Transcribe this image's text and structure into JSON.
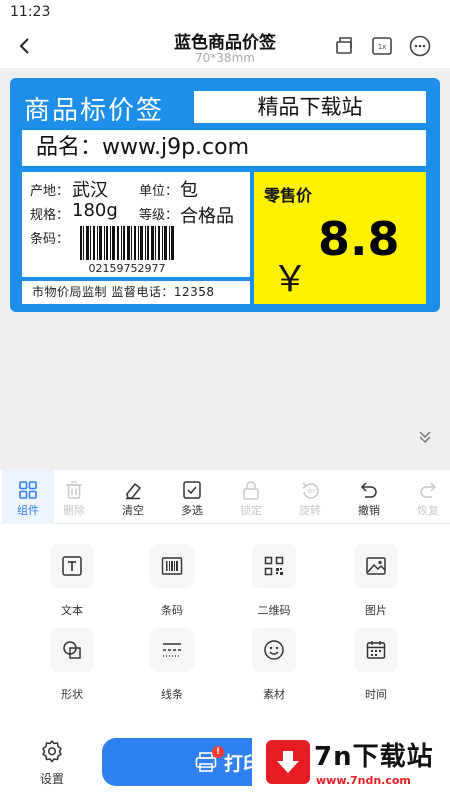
{
  "status_bar": {
    "time": "11:23"
  },
  "header": {
    "title": "蓝色商品价签",
    "subtitle": "70*38mm"
  },
  "label": {
    "heading": "商品标价签",
    "site_name": "精品下载站",
    "product_name": "品名：www.j9p.com",
    "origin_key": "产地：",
    "origin_value": "武汉",
    "unit_key": "单位：",
    "unit_value": "包",
    "spec_key": "规格：",
    "spec_value": "180g",
    "grade_key": "等级：",
    "grade_value": "合格品",
    "barcode_key": "条码：",
    "barcode_number": "02159752977",
    "footer": "市物价局监制 监督电话：12358",
    "price_caption": "零售价",
    "currency": "￥",
    "price": "8.8",
    "colors": {
      "frame": "#1d8fea",
      "price_bg": "#fff200"
    }
  },
  "toolbar": {
    "items": [
      {
        "label": "组件",
        "icon": "grid-icon",
        "active": true,
        "enabled": true
      },
      {
        "label": "删除",
        "icon": "trash-icon",
        "enabled": false
      },
      {
        "label": "清空",
        "icon": "eraser-icon",
        "enabled": true
      },
      {
        "label": "多选",
        "icon": "checkbox-icon",
        "enabled": true
      },
      {
        "label": "锁定",
        "icon": "lock-icon",
        "enabled": false
      },
      {
        "label": "旋转",
        "icon": "rotate-icon",
        "enabled": false
      },
      {
        "label": "撤销",
        "icon": "undo-icon",
        "enabled": true
      },
      {
        "label": "恢复",
        "icon": "redo-icon",
        "enabled": false
      }
    ]
  },
  "components": [
    {
      "label": "文本",
      "icon": "text-icon"
    },
    {
      "label": "条码",
      "icon": "barcode-icon"
    },
    {
      "label": "二维码",
      "icon": "qrcode-icon"
    },
    {
      "label": "图片",
      "icon": "image-icon"
    },
    {
      "label": "形状",
      "icon": "shape-icon"
    },
    {
      "label": "线条",
      "icon": "lines-icon"
    },
    {
      "label": "素材",
      "icon": "sticker-icon"
    },
    {
      "label": "时间",
      "icon": "calendar-icon"
    }
  ],
  "bottom": {
    "settings_label": "设置",
    "print_label": "打印",
    "print_badge": "!"
  },
  "watermark": {
    "text": "7n下载站",
    "url": "www.7ndn.com"
  },
  "theme": {
    "accent": "#2f80f0",
    "disabled": "#c8c8c8"
  }
}
